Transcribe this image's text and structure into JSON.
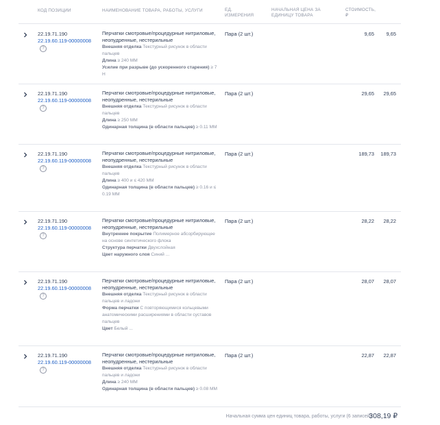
{
  "headers": {
    "code": "Код позиции",
    "name": "Наименование товара, работы, услуги",
    "unit": "Ед. измерения",
    "unit_price": "Начальная цена за единицу товара",
    "cost": "Стоимость, ₽"
  },
  "rows": [
    {
      "okpd": "22.19.71.190",
      "ktru": "22.19.60.119-00000008",
      "name": "Перчатки смотровые/процедурные нитриловые, неопудренные, нестерильные",
      "attrs": [
        {
          "k": "Внешняя отделка",
          "v": "Текстурный рисунок в области пальцев"
        },
        {
          "k": "Длина",
          "v": "≥ 240 ММ"
        },
        {
          "k": "Усилие при разрыве (до ускоренного старения)",
          "v": "≥ 7 Н"
        }
      ],
      "unit": "Пара (2 шт.)",
      "price": "9,65",
      "cost": "9,65"
    },
    {
      "okpd": "22.19.71.190",
      "ktru": "22.19.60.119-00000008",
      "name": "Перчатки смотровые/процедурные нитриловые, неопудренные, нестерильные",
      "attrs": [
        {
          "k": "Внешняя отделка",
          "v": "Текстурный рисунок в области пальцев"
        },
        {
          "k": "Длина",
          "v": "≥ 250 ММ"
        },
        {
          "k": "Одинарная толщина (в области пальцев)",
          "v": "≥ 0.11 ММ"
        }
      ],
      "unit": "Пара (2 шт.)",
      "price": "29,65",
      "cost": "29,65"
    },
    {
      "okpd": "22.19.71.190",
      "ktru": "22.19.60.119-00000008",
      "name": "Перчатки смотровые/процедурные нитриловые, неопудренные, нестерильные",
      "attrs": [
        {
          "k": "Внешняя отделка",
          "v": "Текстурный рисунок в области пальцев"
        },
        {
          "k": "Длина",
          "v": "≥ 400 и ≤ 420 ММ"
        },
        {
          "k": "Одинарная толщина (в области пальцев)",
          "v": "≥ 0.16 и ≤ 0.19 ММ"
        }
      ],
      "unit": "Пара (2 шт.)",
      "price": "189,73",
      "cost": "189,73"
    },
    {
      "okpd": "22.19.71.190",
      "ktru": "22.19.60.119-00000008",
      "name": "Перчатки смотровые/процедурные нитриловые, неопудренные, нестерильные",
      "attrs": [
        {
          "k": "Внутреннее покрытие",
          "v": "Полимерное абсорбирующее на основе синтетического флока"
        },
        {
          "k": "Структура перчатки",
          "v": "Двухслойная"
        },
        {
          "k": "Цвет наружного слоя",
          "v": "Синий ..."
        }
      ],
      "unit": "Пара (2 шт.)",
      "price": "28,22",
      "cost": "28,22"
    },
    {
      "okpd": "22.19.71.190",
      "ktru": "22.19.60.119-00000008",
      "name": "Перчатки смотровые/процедурные нитриловые, неопудренные, нестерильные",
      "attrs": [
        {
          "k": "Внешняя отделка",
          "v": "Текстурный рисунок в области пальцев и ладони"
        },
        {
          "k": "Форма перчатки",
          "v": "С повторяющимися кольцевыми анатомическими расширениями в области суставов пальцев"
        },
        {
          "k": "Цвет",
          "v": "Белый ..."
        }
      ],
      "unit": "Пара (2 шт.)",
      "price": "28,07",
      "cost": "28,07"
    },
    {
      "okpd": "22.19.71.190",
      "ktru": "22.19.60.119-00000008",
      "name": "Перчатки смотровые/процедурные нитриловые, неопудренные, нестерильные",
      "attrs": [
        {
          "k": "Внешняя отделка",
          "v": "Текстурный рисунок в области пальцев и ладони"
        },
        {
          "k": "Длина",
          "v": "≥ 240 ММ"
        },
        {
          "k": "Одинарная толщина (в области пальцев)",
          "v": "≥ 0.08 ММ"
        }
      ],
      "unit": "Пара (2 шт.)",
      "price": "22,87",
      "cost": "22,87"
    }
  ],
  "footer": {
    "label": "Начальная сумма цен единиц товара, работы, услуги (6 записей):",
    "total": "308,19 ₽"
  },
  "help_icon_glyph": "?",
  "colors": {
    "link": "#1f5fc4",
    "muted": "#8d93a3",
    "text": "#334059",
    "divider": "#e3e6ec"
  }
}
